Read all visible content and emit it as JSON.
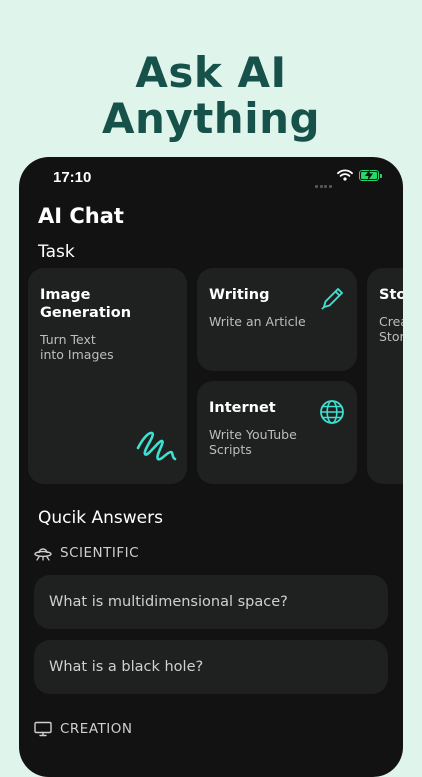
{
  "headline": {
    "line1": "Ask AI",
    "line2": "Anything"
  },
  "status_bar": {
    "time": "17:10"
  },
  "app": {
    "title": "AI Chat"
  },
  "task_section": {
    "title": "Task",
    "cards": [
      {
        "title": "Image\nGeneration",
        "subtitle": "Turn Text\ninto Images",
        "icon": "scribble-icon"
      },
      {
        "title": "Writing",
        "subtitle": "Write an Article",
        "icon": "pencil-icon"
      },
      {
        "title": "Internet",
        "subtitle": "Write YouTube\nScripts",
        "icon": "globe-icon"
      },
      {
        "title": "Sto",
        "subtitle": "Crea\nStor",
        "icon": ""
      }
    ]
  },
  "quick_answers": {
    "title": "Qucik Answers",
    "categories": [
      {
        "label": "SCIENTIFIC",
        "icon": "ufo-icon",
        "questions": [
          "What is multidimensional space?",
          "What is a black hole?"
        ]
      },
      {
        "label": "CREATION",
        "icon": "monitor-icon",
        "questions": []
      }
    ]
  },
  "colors": {
    "accent": "#3ee0d0",
    "background": "#dff5ec",
    "headline": "#16524a",
    "phone_bg": "#121212",
    "card_bg": "#1e2120"
  }
}
